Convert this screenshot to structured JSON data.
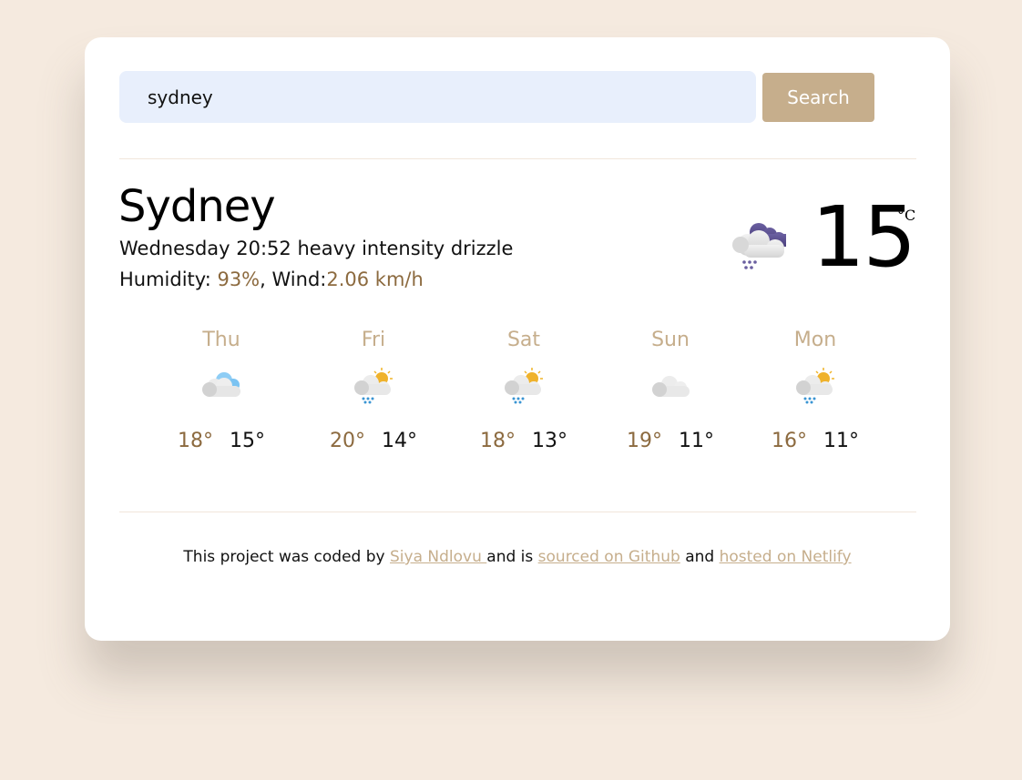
{
  "search": {
    "value": "sydney",
    "button_label": "Search"
  },
  "current": {
    "city": "Sydney",
    "day_time": "Wednesday 20:52",
    "description": "heavy intensity drizzle",
    "humidity_label": "Humidity: ",
    "humidity_value": "93%",
    "wind_label": ", Wind:",
    "wind_value": "2.06 km/h",
    "temperature": "15",
    "unit": "°C",
    "icon": "rain-cloud-night-icon"
  },
  "forecast": [
    {
      "day": "Thu",
      "max": "18°",
      "min": "15°",
      "icon": "cloudy-icon"
    },
    {
      "day": "Fri",
      "max": "20°",
      "min": "14°",
      "icon": "sun-rain-cloud-icon"
    },
    {
      "day": "Sat",
      "max": "18°",
      "min": "13°",
      "icon": "sun-rain-cloud-icon"
    },
    {
      "day": "Sun",
      "max": "19°",
      "min": "11°",
      "icon": "cloud-icon"
    },
    {
      "day": "Mon",
      "max": "16°",
      "min": "11°",
      "icon": "sun-rain-cloud-icon"
    }
  ],
  "footer": {
    "prefix": "This project was coded by ",
    "author_link": "Siya Ndlovu ",
    "middle1": "and is ",
    "github_link": "sourced on Github",
    "middle2": " and ",
    "netlify_link": "hosted on Netlify"
  },
  "colors": {
    "accent_gold": "#8c6a3f",
    "accent_tan": "#c6ae8c",
    "input_bg": "#e8effc",
    "page_bg": "#f5eadf"
  }
}
